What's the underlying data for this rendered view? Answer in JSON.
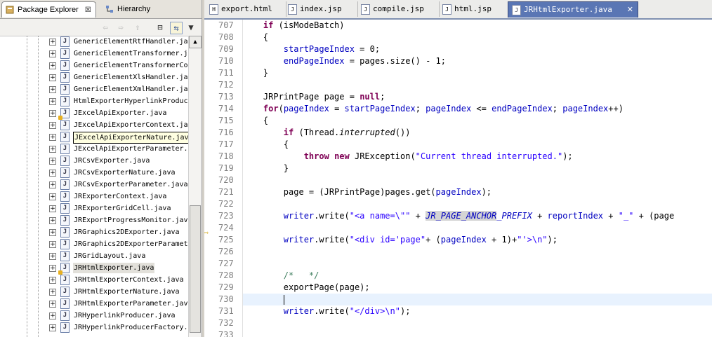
{
  "left_view": {
    "tabs": [
      {
        "label": "Package Explorer",
        "active": true
      },
      {
        "label": "Hierarchy",
        "active": false
      }
    ],
    "tree_items": [
      {
        "label": "GenericElementRtfHandler.ja",
        "icon": "java-file-icon"
      },
      {
        "label": "GenericElementTransformer.j",
        "icon": "java-file-icon"
      },
      {
        "label": "GenericElementTransformerCo",
        "icon": "java-file-icon"
      },
      {
        "label": "GenericElementXlsHandler.ja",
        "icon": "java-file-icon"
      },
      {
        "label": "GenericElementXmlHandler.ja",
        "icon": "java-file-icon"
      },
      {
        "label": "HtmlExporterHyperlinkProduc",
        "icon": "java-file-icon"
      },
      {
        "label": "JExcelApiExporter.java",
        "icon": "java-file-warning-icon"
      },
      {
        "label": "JExcelApiExporterContext.ja",
        "icon": "java-file-icon"
      },
      {
        "label": "JExcelApiExporterNature.java",
        "icon": "java-file-icon",
        "tooltip": true
      },
      {
        "label": "JExcelApiExporterParameter.",
        "icon": "java-file-icon"
      },
      {
        "label": "JRCsvExporter.java",
        "icon": "java-file-icon"
      },
      {
        "label": "JRCsvExporterNature.java",
        "icon": "java-file-icon"
      },
      {
        "label": "JRCsvExporterParameter.java",
        "icon": "java-file-icon"
      },
      {
        "label": "JRExporterContext.java",
        "icon": "java-file-icon"
      },
      {
        "label": "JRExporterGridCell.java",
        "icon": "java-file-icon"
      },
      {
        "label": "JRExportProgressMonitor.jav",
        "icon": "java-file-icon"
      },
      {
        "label": "JRGraphics2DExporter.java",
        "icon": "java-file-icon"
      },
      {
        "label": "JRGraphics2DExporterParamet",
        "icon": "java-file-icon"
      },
      {
        "label": "JRGridLayout.java",
        "icon": "java-file-icon"
      },
      {
        "label": "JRHtmlExporter.java",
        "icon": "java-file-warning-icon",
        "selected": true
      },
      {
        "label": "JRHtmlExporterContext.java",
        "icon": "java-file-icon"
      },
      {
        "label": "JRHtmlExporterNature.java",
        "icon": "java-file-icon"
      },
      {
        "label": "JRHtmlExporterParameter.jav",
        "icon": "java-file-icon"
      },
      {
        "label": "JRHyperlinkProducer.java",
        "icon": "java-file-icon"
      },
      {
        "label": "JRHyperlinkProducerFactory.",
        "icon": "java-file-icon"
      }
    ]
  },
  "editor": {
    "tabs": [
      {
        "label": "export.html",
        "active": false
      },
      {
        "label": "index.jsp",
        "active": false
      },
      {
        "label": "compile.jsp",
        "active": false
      },
      {
        "label": "html.jsp",
        "active": false
      },
      {
        "label": "JRHtmlExporter.java",
        "active": true
      }
    ],
    "line_numbers": [
      "707",
      "708",
      "709",
      "710",
      "711",
      "712",
      "713",
      "714",
      "715",
      "716",
      "717",
      "718",
      "719",
      "720",
      "721",
      "722",
      "723",
      "724",
      "725",
      "726",
      "727",
      "728",
      "729",
      "730",
      "731",
      "732",
      "733"
    ],
    "code": {
      "l707": {
        "kw": "if",
        "rest": " (isModeBatch)"
      },
      "l708": "{",
      "l709": {
        "fld": "startPageIndex",
        "rest": " = 0;"
      },
      "l710": {
        "fld": "endPageIndex",
        "rest": " = pages.size() - 1;"
      },
      "l711": "}",
      "l713": {
        "pre": "JRPrintPage page = ",
        "kw": "null",
        "post": ";"
      },
      "l714": {
        "kw": "for",
        "a": "(",
        "f1": "pageIndex",
        "b": " = ",
        "f2": "startPageIndex",
        "c": "; ",
        "f3": "pageIndex",
        "d": " <= ",
        "f4": "endPageIndex",
        "e": "; ",
        "f5": "pageIndex",
        "g": "++)"
      },
      "l715": "{",
      "l716": {
        "kw": "if",
        "a": " (Thread.",
        "m": "interrupted",
        "b": "())"
      },
      "l717": "{",
      "l718": {
        "kw1": "throw",
        "kw2": "new",
        "a": " JRException(",
        "s": "\"Current thread interrupted.\"",
        "b": ");"
      },
      "l719": "}",
      "l721": {
        "a": "page = (JRPrintPage)pages.get(",
        "f": "pageIndex",
        "b": ");"
      },
      "l723": {
        "f1": "writer",
        "a": ".write(",
        "s1": "\"<a name=\\\"\"",
        "b": " + ",
        "sf1": "JR_PAGE_ANCHOR",
        "sf2": "_PREFIX",
        "c": " + ",
        "f2": "reportIndex",
        "d": " + ",
        "s2": "\"_\"",
        "e": " + (page"
      },
      "l725": {
        "f1": "writer",
        "a": ".write(",
        "s1": "\"<div id='page\"",
        "b": "+ (",
        "f2": "pageIndex",
        "c": " + 1)+",
        "s2": "\"'>\\n\"",
        "d": ");"
      },
      "l728": "/*   */",
      "l729": "exportPage(page);",
      "l731": {
        "f": "writer",
        "a": ".write(",
        "s": "\"</div>\\n\"",
        "b": ");"
      }
    }
  }
}
